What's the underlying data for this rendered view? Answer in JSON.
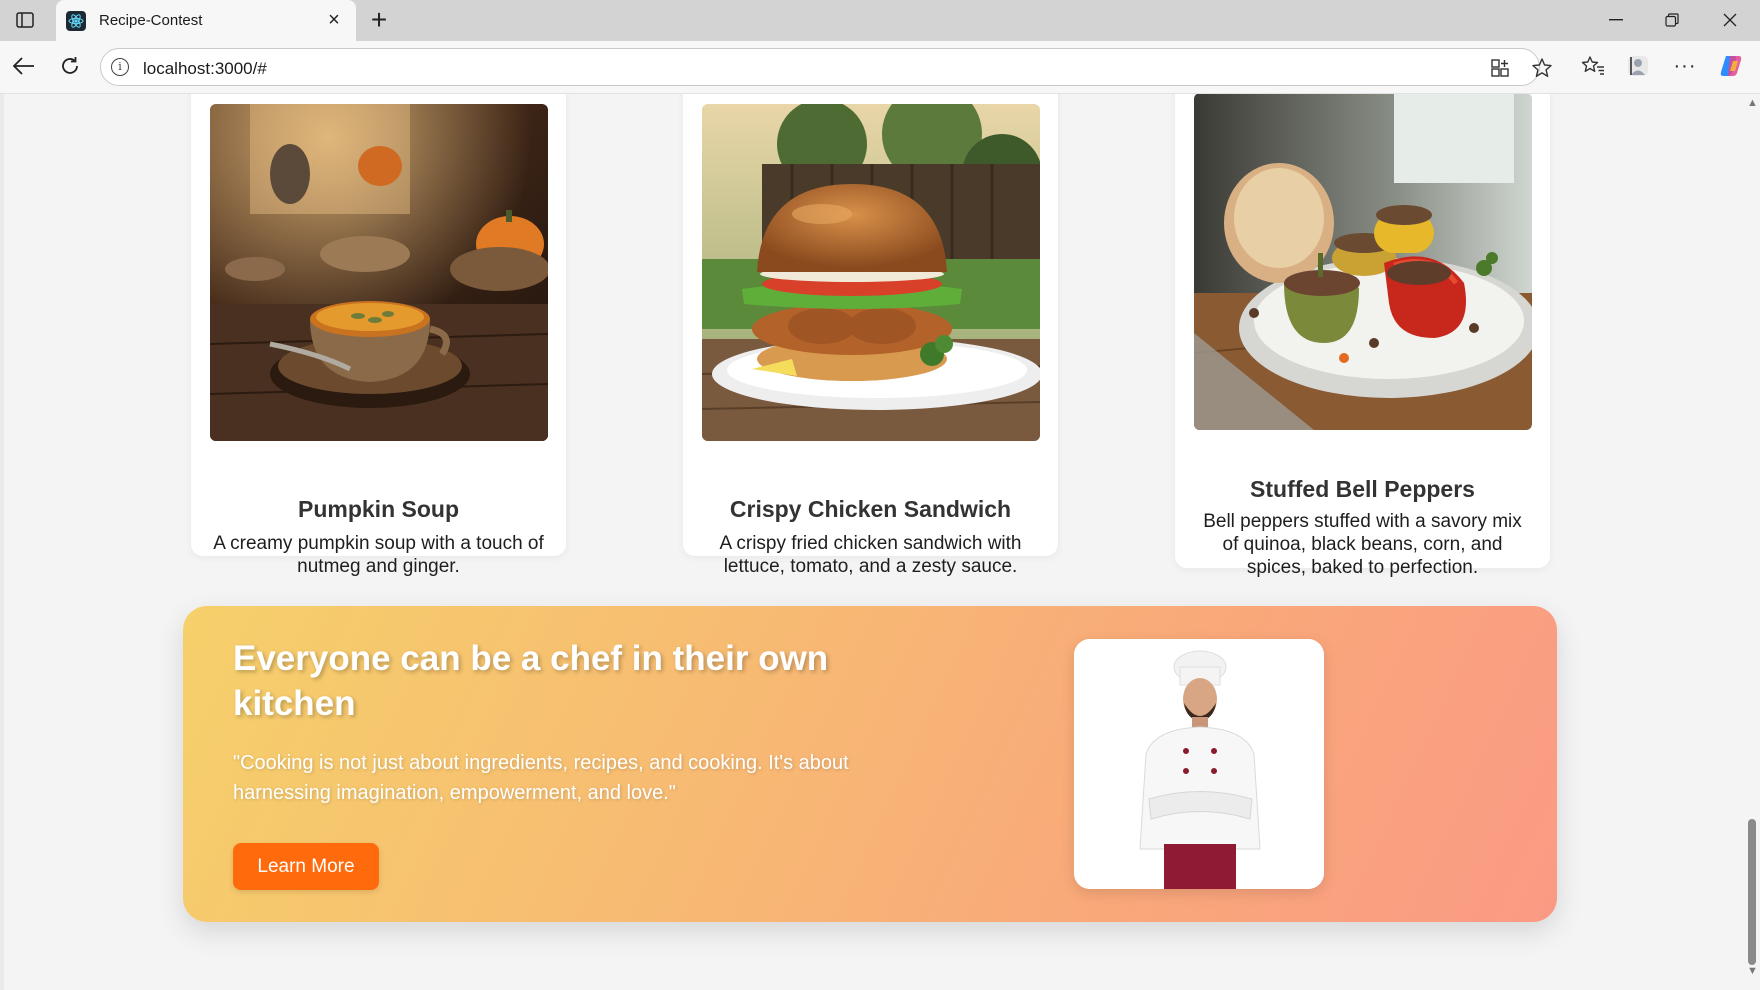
{
  "browser": {
    "tab_title": "Recipe-Contest",
    "url": "localhost:3000/#"
  },
  "recipes": [
    {
      "title": "Pumpkin Soup",
      "description": "A creamy pumpkin soup with a touch of nutmeg and ginger."
    },
    {
      "title": "Crispy Chicken Sandwich",
      "description": "A crispy fried chicken sandwich with lettuce, tomato, and a zesty sauce."
    },
    {
      "title": "Stuffed Bell Peppers",
      "description": "Bell peppers stuffed with a savory mix of quinoa, black beans, corn, and spices, baked to perfection."
    }
  ],
  "banner": {
    "title": "Everyone can be a chef in their own kitchen",
    "quote": "\"Cooking is not just about ingredients, recipes, and cooking. It's about harnessing imagination, empowerment, and love.\"",
    "button_label": "Learn More"
  },
  "colors": {
    "accent_button": "#ff6a0d",
    "banner_gradient_start": "#f6d06a",
    "banner_gradient_end": "#fb9a84",
    "page_background": "#f4f4f4"
  }
}
